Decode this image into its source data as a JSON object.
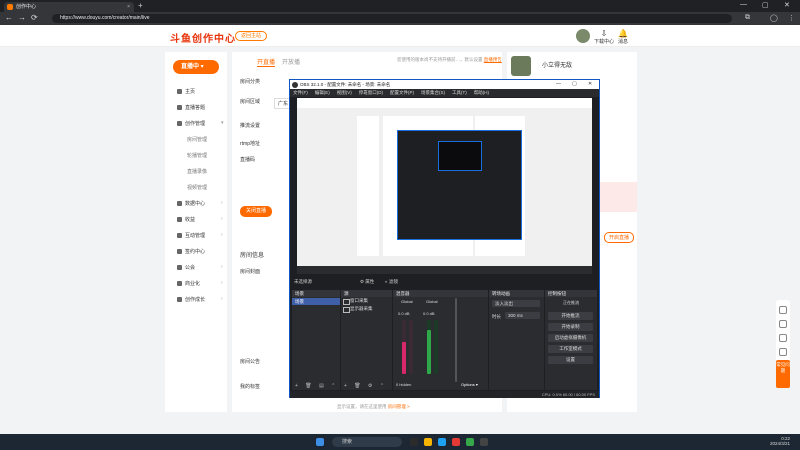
{
  "browser": {
    "tab_title": "创作中心",
    "url": "https://www.douyu.com/creator/main/live",
    "new_tab": "+",
    "win_min": "—",
    "win_max": "▢",
    "win_close": "✕",
    "back": "←",
    "forward": "→",
    "reload": "⟳"
  },
  "site_header": {
    "logo": "斗鱼创作中心",
    "back_button": "返回主站",
    "download_label": "下载中心",
    "message_label": "消息"
  },
  "sidebar": {
    "live_button": "直播中 ▾",
    "items": [
      {
        "label": "主页",
        "sub": false
      },
      {
        "label": "直播答题",
        "sub": false
      },
      {
        "label": "创作管理",
        "sub": false,
        "chevron": "▾"
      },
      {
        "label": "房间管理",
        "sub": true
      },
      {
        "label": "轮播管理",
        "sub": true
      },
      {
        "label": "直播录像",
        "sub": true
      },
      {
        "label": "视频管理",
        "sub": true
      },
      {
        "label": "数据中心",
        "sub": false,
        "chevron": "›"
      },
      {
        "label": "收益",
        "sub": false,
        "chevron": "›"
      },
      {
        "label": "互动管理",
        "sub": false,
        "chevron": "›"
      },
      {
        "label": "签约中心",
        "sub": false
      },
      {
        "label": "公会",
        "sub": false,
        "chevron": "›"
      },
      {
        "label": "商业化",
        "sub": false,
        "chevron": "›"
      },
      {
        "label": "创作成长",
        "sub": false,
        "chevron": "›"
      }
    ]
  },
  "main": {
    "tab_live": "开直播",
    "tab_open": "开放播",
    "notice_text": "您使用的版本尚不支持开播前…，默认设置",
    "notice_link": "直播预告",
    "label_type": "房间分类",
    "label_area": "房间区域",
    "area_value": "广东",
    "push_title": "推流设置",
    "label_rtmp": "rtmp地址",
    "label_key": "直播码",
    "close_live": "关闭直播",
    "room_info": "房间信息",
    "label_cover": "房间封面",
    "label_announce": "房间公告",
    "label_tags": "我的标签",
    "bottom_note": "显示设置，请在这里使用",
    "bottom_link": "房间管理 >"
  },
  "right_panel": {
    "name": "小立得无敌",
    "button": "开启直播"
  },
  "float_bar": {
    "badge": "常见问题"
  },
  "obs": {
    "title": "OBS 32.1.0 - 配置文件: 未命名 - 场景: 未命名",
    "menus": [
      "文件(F)",
      "编辑(E)",
      "视图(V)",
      "停靠窗口(D)",
      "配置文件(P)",
      "场景集合(S)",
      "工具(T)",
      "帮助(H)"
    ],
    "source_selected": "未选择源",
    "props_tab": "⚙ 属性",
    "filters_tab": "◐ 滤镜",
    "scenes_header": "场景",
    "scene_name": "场景",
    "sources_header": "源",
    "sources": [
      "窗口采集",
      "显示器采集"
    ],
    "mixer_header": "混音器",
    "mixer_ch1": "Global",
    "mixer_ch2": "Global",
    "db1": "0.0 dB",
    "db2": "0.0 dB",
    "hidden_label": "0 hidden",
    "options_label": "Options ▾",
    "transitions_header": "转场动画",
    "transition_type": "淡入淡出",
    "duration_label": "时长",
    "duration_value": "300 ms",
    "controls_header": "控制按钮",
    "controls": [
      "开始推流",
      "开始录制",
      "启动虚拟摄像机",
      "工作室模式",
      "设置"
    ],
    "controls_status": "正在推流",
    "status_bar": "CPU: 0.0%  60.00 / 60.00 FPS",
    "footer_scenes": "+ 🗑 ▤ ⌃ ⌄",
    "footer_sources": "+ 🗑 ⚙ ⌃ ⌄"
  },
  "taskbar": {
    "search": "搜索",
    "time": "0:22",
    "date": "2024/3/21"
  }
}
